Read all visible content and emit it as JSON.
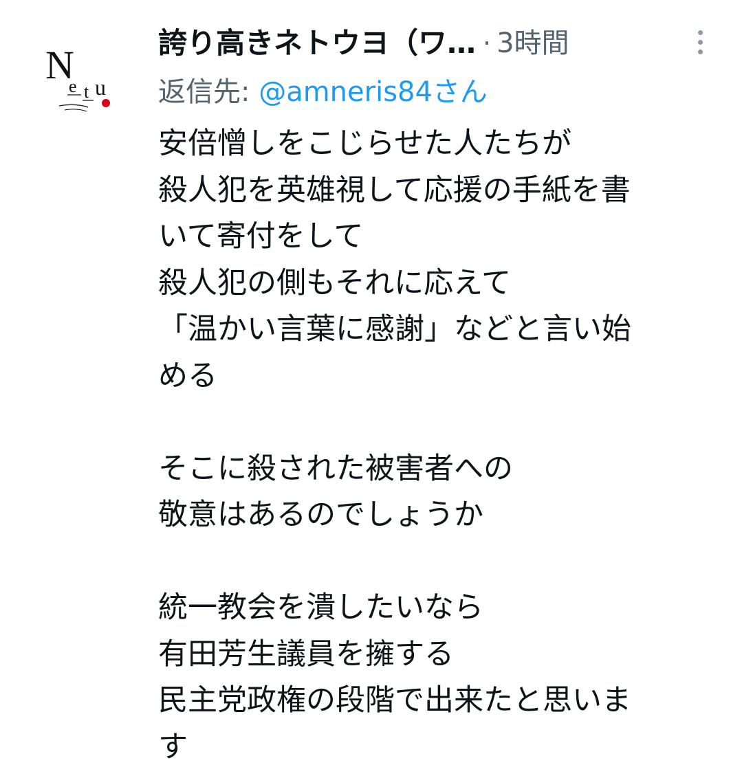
{
  "tweet": {
    "display_name": "誇り高きネトウヨ（ワ…",
    "separator": "·",
    "timestamp": "3時間",
    "reply_prefix": "返信先: ",
    "reply_handle": "@amneris84さん",
    "avatar_text": "Netu",
    "icons": {
      "avatar": "netu-logo-avatar",
      "more": "vertical-ellipsis-icon"
    },
    "colors": {
      "text": "#0f1419",
      "secondary": "#536471",
      "link": "#1d9bf0",
      "avatar_dot": "#e0001b"
    },
    "lines": [
      "安倍憎しをこじらせた人たちが",
      "殺人犯を英雄視して応援の手紙を書",
      "いて寄付をして",
      "殺人犯の側もそれに応えて",
      "「温かい言葉に感謝」などと言い始",
      "める",
      "",
      "そこに殺された被害者への",
      "敬意はあるのでしょうか",
      "",
      "統一教会を潰したいなら",
      "有田芳生議員を擁する",
      "民主党政権の段階で出来たと思いま",
      "す"
    ]
  }
}
